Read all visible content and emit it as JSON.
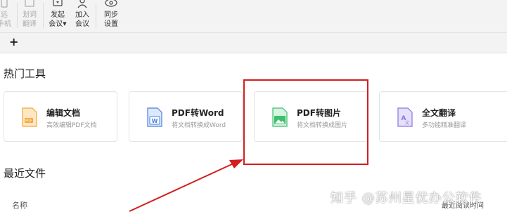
{
  "toolbar": {
    "items": [
      {
        "line1": "远",
        "line2": "手机",
        "icon": "phone-icon",
        "disabled": true
      },
      {
        "line1": "划词",
        "line2": "翻译",
        "icon": "translate-select-icon",
        "disabled": true
      },
      {
        "line1": "发起",
        "line2": "会议",
        "icon": "meeting-icon",
        "disabled": false,
        "has_caret": true
      },
      {
        "line1": "加入",
        "line2": "会议",
        "icon": "join-meeting-icon",
        "disabled": false
      },
      {
        "line1": "同步",
        "line2": "设置",
        "icon": "sync-icon",
        "disabled": false
      }
    ]
  },
  "tabstrip": {
    "add_label": "+"
  },
  "hot_tools": {
    "title": "热门工具",
    "cards": [
      {
        "name": "编辑文档",
        "desc": "高效编辑PDF文档",
        "icon": "edit-pdf-icon",
        "color": "#f5a63a"
      },
      {
        "name": "PDF转Word",
        "desc": "将文档转换成Word",
        "icon": "pdf-to-word-icon",
        "color": "#4a7fe0"
      },
      {
        "name": "PDF转图片",
        "desc": "将文档转换成图片",
        "icon": "pdf-to-image-icon",
        "color": "#3cbf6e"
      },
      {
        "name": "全文翻译",
        "desc": "多功能精准翻译",
        "icon": "translate-icon",
        "color": "#8b76e0"
      }
    ]
  },
  "recent_files": {
    "title": "最近文件",
    "columns": {
      "name": "名称",
      "time": "最近阅读时间"
    }
  },
  "watermark": "知乎 @苏州星优办公软件",
  "colors": {
    "highlight": "#d21e1e",
    "arrow": "#d21e1e"
  }
}
